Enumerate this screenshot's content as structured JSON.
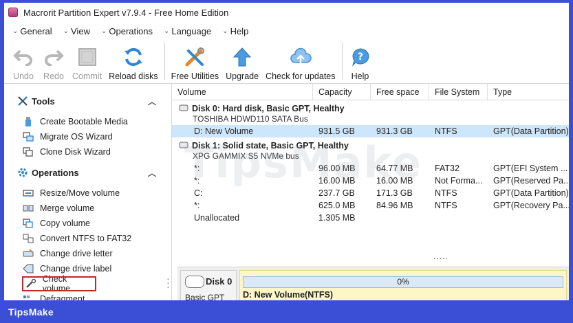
{
  "window": {
    "title": "Macrorit Partition Expert v7.9.4 - Free Home Edition"
  },
  "menu": [
    {
      "label": "General"
    },
    {
      "label": "View"
    },
    {
      "label": "Operations"
    },
    {
      "label": "Language"
    },
    {
      "label": "Help"
    }
  ],
  "toolbar": {
    "undo": "Undo",
    "redo": "Redo",
    "commit": "Commit",
    "reload": "Reload disks",
    "utilities": "Free Utilities",
    "upgrade": "Upgrade",
    "updates": "Check for updates",
    "help": "Help"
  },
  "tools": {
    "heading": "Tools",
    "items": [
      "Create Bootable Media",
      "Migrate OS Wizard",
      "Clone Disk Wizard"
    ]
  },
  "operations": {
    "heading": "Operations",
    "items": [
      "Resize/Move volume",
      "Merge volume",
      "Copy volume",
      "Convert NTFS to FAT32",
      "Change drive letter",
      "Change drive label",
      "Check volume",
      "Defragment"
    ]
  },
  "table": {
    "headers": [
      "Volume",
      "Capacity",
      "Free space",
      "File System",
      "Type"
    ],
    "disk0": {
      "title": "Disk 0: Hard disk, Basic GPT, Healthy",
      "model": "TOSHIBA HDWD110 SATA Bus",
      "rows": [
        {
          "volume": "D: New Volume",
          "capacity": "931.5 GB",
          "free": "931.3 GB",
          "fs": "NTFS",
          "type": "GPT(Data Partition)"
        }
      ]
    },
    "disk1": {
      "title": "Disk 1: Solid state, Basic GPT, Healthy",
      "model": "XPG GAMMIX S5 NVMe bus",
      "rows": [
        {
          "volume": "*:",
          "capacity": "96.00 MB",
          "free": "64.77 MB",
          "fs": "FAT32",
          "type": "GPT(EFI System ..."
        },
        {
          "volume": "*:",
          "capacity": "16.00 MB",
          "free": "16.00 MB",
          "fs": "Not Forma...",
          "type": "GPT(Reserved Pa..."
        },
        {
          "volume": "C:",
          "capacity": "237.7 GB",
          "free": "171.3 GB",
          "fs": "NTFS",
          "type": "GPT(Data Partition)"
        },
        {
          "volume": "*:",
          "capacity": "625.0 MB",
          "free": "84.96 MB",
          "fs": "NTFS",
          "type": "GPT(Recovery Pa..."
        },
        {
          "volume": "Unallocated",
          "capacity": "1.305 MB",
          "free": "",
          "fs": "",
          "type": ""
        }
      ]
    },
    "more": "....."
  },
  "diskmap": {
    "disk_label": "Disk 0",
    "disk_type": "Basic GPT",
    "usage_percent": "0%",
    "partition_label": "D: New Volume(NTFS)"
  },
  "watermark": "TipsMake",
  "footer": {
    "brand": "TipsMake"
  }
}
